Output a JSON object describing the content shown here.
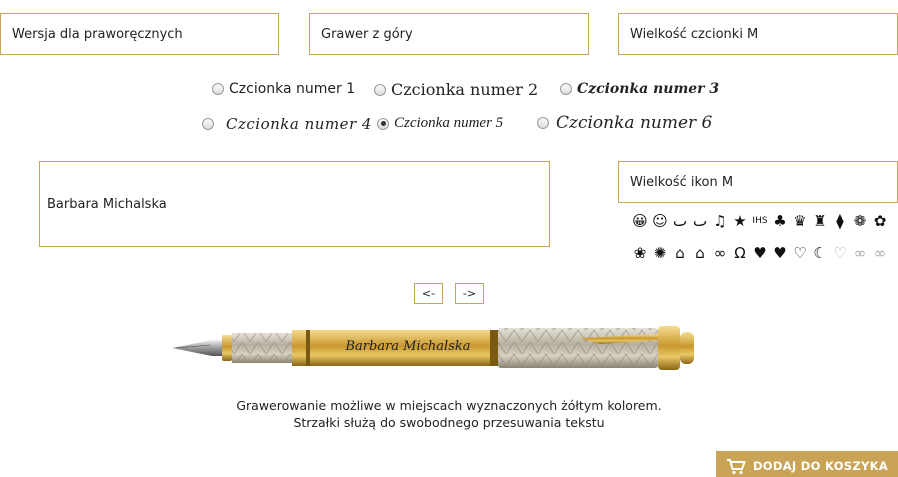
{
  "selects": {
    "hand": "Wersja dla praworęcznych",
    "position": "Grawer z góry",
    "font_size": "Wielkość czcionki M",
    "icon_size": "Wielkość ikon M"
  },
  "fonts": [
    {
      "label": "Czcionka numer 1",
      "checked": false
    },
    {
      "label": "Czcionka numer 2",
      "checked": false
    },
    {
      "label": "Czcionka numer 3",
      "checked": false
    },
    {
      "label": "Czcionka numer 4",
      "checked": false
    },
    {
      "label": "Czcionka numer 5",
      "checked": true
    },
    {
      "label": "Czcionka numer 6",
      "checked": false
    }
  ],
  "engraving_text": "Barbara Michalska",
  "icons_row1": [
    {
      "name": "smile-big-icon",
      "glyph": "😀"
    },
    {
      "name": "smile-icon",
      "glyph": "☺"
    },
    {
      "name": "wink-face-icon",
      "glyph": "ٮ"
    },
    {
      "name": "grin-face-icon",
      "glyph": "ٮ"
    },
    {
      "name": "music-note-icon",
      "glyph": "♫"
    },
    {
      "name": "star-icon",
      "glyph": "★"
    },
    {
      "name": "ihs-icon",
      "glyph": "IHS"
    },
    {
      "name": "clover-icon",
      "glyph": "♣"
    },
    {
      "name": "crown-icon",
      "glyph": "♛"
    },
    {
      "name": "cat-icon",
      "glyph": "♜"
    },
    {
      "name": "tie-icon",
      "glyph": "⧫"
    },
    {
      "name": "flower-icon",
      "glyph": "❁"
    },
    {
      "name": "rose-icon",
      "glyph": "✿"
    }
  ],
  "icons_row2": [
    {
      "name": "paw-icon",
      "glyph": "❀"
    },
    {
      "name": "medal-icon",
      "glyph": "✺"
    },
    {
      "name": "graduation-cap-icon",
      "glyph": "⌂"
    },
    {
      "name": "graduation-hat-icon",
      "glyph": "⌂"
    },
    {
      "name": "rings-icon",
      "glyph": "∞"
    },
    {
      "name": "horseshoe-icon",
      "glyph": "Ω"
    },
    {
      "name": "heart-outline-bold-icon",
      "glyph": "♥"
    },
    {
      "name": "heart-icon",
      "glyph": "♥"
    },
    {
      "name": "heart-outline-icon",
      "glyph": "♡"
    },
    {
      "name": "crescent-icon",
      "glyph": "☾"
    },
    {
      "name": "heart-thin-icon",
      "glyph": "♡"
    },
    {
      "name": "infinity-icon",
      "glyph": "∞"
    },
    {
      "name": "infinity-alt-icon",
      "glyph": "∞"
    }
  ],
  "nav": {
    "left": "<-",
    "right": "->"
  },
  "info": {
    "line1": "Grawerowanie możliwe w miejscach wyznaczonych żółtym kolorem.",
    "line2": "Strzałki służą do swobodnego przesuwania tekstu"
  },
  "cart": {
    "label": "DODAJ DO KOSZYKA",
    "icon": "cart-icon"
  },
  "colors": {
    "accent": "#c9a457"
  }
}
